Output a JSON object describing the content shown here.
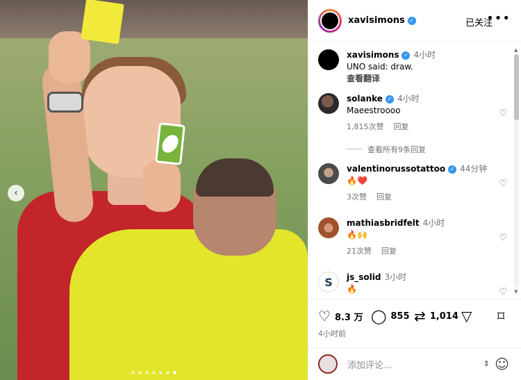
{
  "post": {
    "username": "xavisimons",
    "follow_label": "已关注",
    "more_label": "•••",
    "caption_time": "4小时",
    "caption_text": "UNO said: draw.",
    "translate_label": "查看翻译"
  },
  "comments": [
    {
      "username": "solanke",
      "verified": true,
      "time": "4小时",
      "text": "Maeestroooo",
      "likes": "1,815次赞",
      "reply": "回复"
    },
    {
      "username": "valentinorussotattoo",
      "verified": true,
      "time": "44分钟",
      "text": "🔥❤️",
      "likes": "3次赞",
      "reply": "回复"
    },
    {
      "username": "mathiasbridfelt",
      "verified": false,
      "time": "4小时",
      "text": "🔥🙌",
      "likes": "21次赞",
      "reply": "回复"
    },
    {
      "username": "js_solid",
      "verified": false,
      "time": "3小时",
      "text": "🔥",
      "likes": "",
      "reply": ""
    }
  ],
  "view_replies": "查看所有9条回复",
  "actions": {
    "likes": "8.3 万",
    "comments": "855",
    "reposts": "1,014",
    "time": "4小时前"
  },
  "compose": {
    "placeholder": "添加评论..."
  },
  "icons": {
    "heart": "heart-icon",
    "comment": "comment-icon",
    "repost": "repost-icon",
    "share": "share-icon",
    "save": "bookmark-icon",
    "emoji": "emoji-icon"
  },
  "colors": {
    "verified": "#3897f0",
    "muted": "#737373",
    "referee_shirt": "#e2e52a",
    "player_shirt": "#c3252b"
  }
}
